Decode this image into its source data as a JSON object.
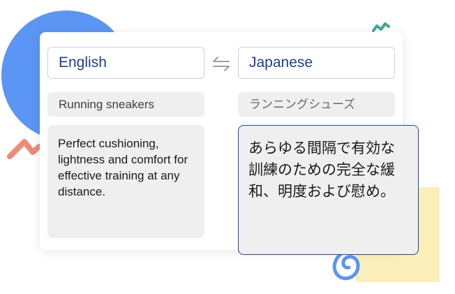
{
  "translator": {
    "source_language": "English",
    "target_language": "Japanese",
    "source_label": "Running sneakers",
    "target_label": "ランニングシューズ",
    "source_text": "Perfect cushioning, lightness and comfort for effective training at any distance.",
    "target_text": "あらゆる間隔で有効な訓練のための完全な緩和、明度および慰め。"
  },
  "icons": {
    "swap": "swap-arrows-icon"
  },
  "colors": {
    "accent_blue": "#1f4796",
    "decor_blue": "#5b96f4",
    "decor_yellow": "#fbefb9",
    "decor_coral": "#f08a78",
    "decor_teal": "#3fa98e",
    "panel_gray": "#efefef"
  }
}
